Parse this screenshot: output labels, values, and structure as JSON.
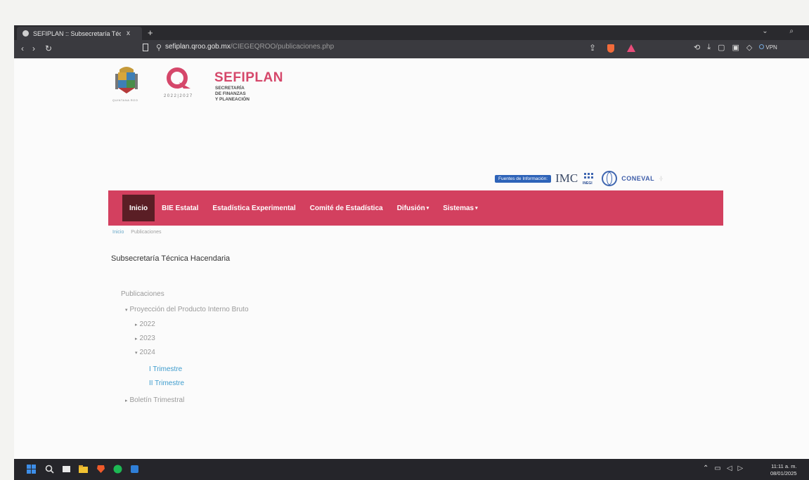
{
  "browser": {
    "tab_title": "SEFIPLAN :: Subsecretaría Técn",
    "tab_close": "x",
    "new_tab": "+",
    "url_host": "sefiplan.qroo.gob.mx",
    "url_path": "/CIEGEQROO/publicaciones.php",
    "vpn_label": "VPN"
  },
  "header": {
    "logo_years": "2022|2027",
    "brand_name": "SEFIPLAN",
    "brand_sub_1": "SECRETARÍA",
    "brand_sub_2": "DE FINANZAS",
    "brand_sub_3": "Y PLANEACIÓN",
    "sources_label": "Fuentes de Información:",
    "imco": "IMC",
    "inegi": "INEGI",
    "coneval": "CONEVAL"
  },
  "nav": {
    "items": [
      {
        "label": "Inicio"
      },
      {
        "label": "BIE Estatal"
      },
      {
        "label": "Estadística Experimental"
      },
      {
        "label": "Comité de Estadística"
      },
      {
        "label": "Difusión"
      },
      {
        "label": "Sistemas"
      }
    ]
  },
  "breadcrumb": {
    "home": "Inicio",
    "current": "Publicaciones"
  },
  "section_title": "Subsecretaría Técnica Hacendaria",
  "tree": {
    "root": "Publicaciones",
    "pib": "Proyección del Producto Interno Bruto",
    "y2022": "2022",
    "y2023": "2023",
    "y2024": "2024",
    "t1": "I Trimestre",
    "t2": "II Trimestre",
    "boletin": "Boletín Trimestral"
  },
  "taskbar": {
    "time": "11:11 a. m.",
    "date": "08/01/2025"
  },
  "colors": {
    "navbar": "#d3405f",
    "nav_active": "#5a1e25",
    "brand": "#d5476a",
    "link": "#3e9ccd"
  }
}
